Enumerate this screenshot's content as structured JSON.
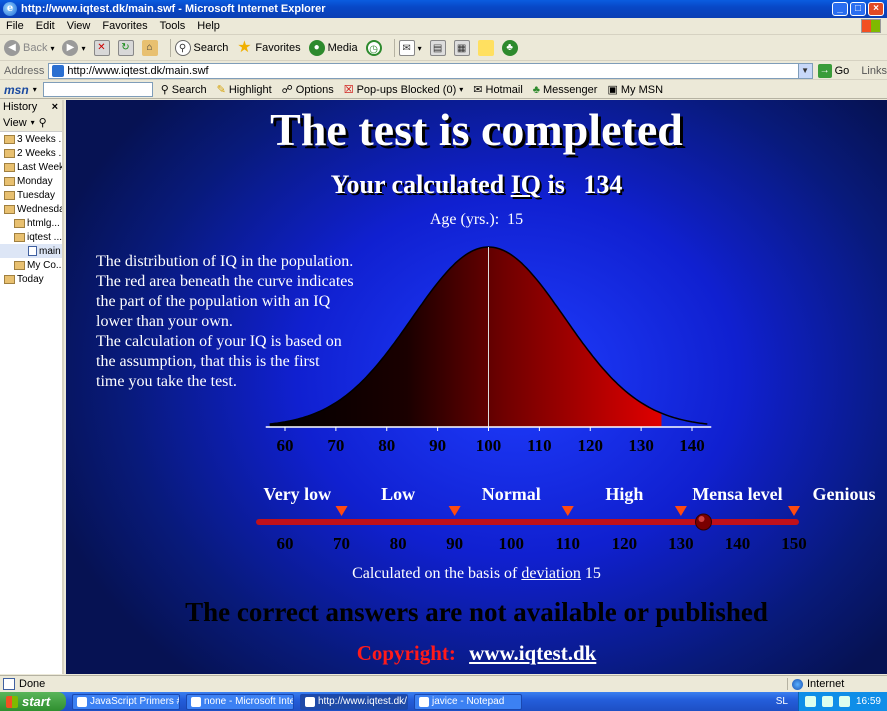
{
  "window": {
    "title": "http://www.iqtest.dk/main.swf - Microsoft Internet Explorer",
    "buttons": [
      "_",
      "□",
      "×"
    ]
  },
  "menu": [
    "File",
    "Edit",
    "View",
    "Favorites",
    "Tools",
    "Help"
  ],
  "toolbar": {
    "back": "Back",
    "search": "Search",
    "favorites": "Favorites",
    "media": "Media"
  },
  "address": {
    "label": "Address",
    "value": "http://www.iqtest.dk/main.swf",
    "go": "Go",
    "links": "Links"
  },
  "msnbar": {
    "logo": "msn",
    "search": "Search",
    "highlight": "Highlight",
    "options": "Options",
    "popups": "Pop-ups Blocked (0)",
    "hotmail": "Hotmail",
    "messenger": "Messenger",
    "mymsn": "My MSN"
  },
  "history": {
    "title": "History",
    "close": "×",
    "view": "View",
    "items": [
      "3 Weeks ...",
      "2 Weeks ...",
      "Last Week",
      "Monday",
      "Tuesday",
      "Wednesday",
      "htmlg...",
      "iqtest ...",
      "main",
      "My Co...",
      "Today"
    ]
  },
  "content": {
    "title": "The test is completed",
    "iq_prefix": "Your calculated",
    "iq_link": "IQ",
    "iq_is": "is",
    "iq_value": "134",
    "age_label": "Age (yrs.):",
    "age_value": "15",
    "description": [
      "The distribution of IQ in the population.",
      "The red area beneath the curve indicates",
      "the part of the population with an IQ",
      "lower than your own.",
      "The calculation of your IQ is based on",
      "the assumption, that this is the first",
      "time you take the test."
    ],
    "note_prefix": "Calculated on the basis of",
    "note_link": "deviation",
    "note_value": "15",
    "warning": "The correct answers are not available or published",
    "copyright_label": "Copyright:",
    "copyright_link": "www.iqtest.dk"
  },
  "chart_data": {
    "type": "area",
    "title": "",
    "curve": {
      "x_ticks": [
        60,
        70,
        80,
        90,
        100,
        110,
        120,
        130,
        140
      ],
      "xlim": [
        57,
        143
      ],
      "mean": 100,
      "sd": 15,
      "shaded_upto": 134
    },
    "scale": {
      "ticks": [
        60,
        70,
        80,
        90,
        100,
        110,
        120,
        130,
        140,
        150
      ],
      "categories": [
        "Very low",
        "Low",
        "Normal",
        "High",
        "Mensa level",
        "Genious"
      ],
      "boundaries": [
        70,
        90,
        110,
        130,
        150
      ],
      "marker": 134
    },
    "colors": {
      "shade": "#e00000",
      "dark": "#000000",
      "axis": "#ffffff",
      "scale_bar": "#c0101a",
      "tick_text": "#000000"
    }
  },
  "status": {
    "text": "Done",
    "zone": "Internet"
  },
  "taskbar": {
    "start": "start",
    "tasks": [
      "JavaScript Primers #...",
      "none - Microsoft Inte...",
      "http://www.iqtest.dk/...",
      "javice - Notepad"
    ],
    "lang": "SL",
    "time": "16:59"
  }
}
